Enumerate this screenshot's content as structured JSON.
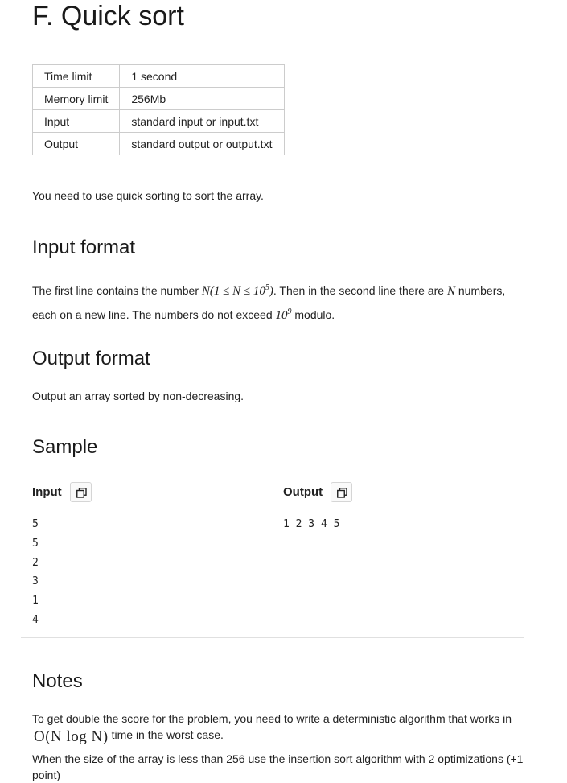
{
  "problem": {
    "title": "F. Quick sort"
  },
  "limits": [
    {
      "key": "Time limit",
      "value": "1 second"
    },
    {
      "key": "Memory limit",
      "value": "256Mb"
    },
    {
      "key": "Input",
      "value": "standard input or input.txt"
    },
    {
      "key": "Output",
      "value": "standard output or output.txt"
    }
  ],
  "legend": "You need to use quick sorting to sort the array.",
  "input_format": {
    "heading": "Input format",
    "text_1": "The first line contains the number ",
    "math_1": "N(1 ≤ N ≤ 10",
    "math_1_sup": "5",
    "math_1_end": ")",
    "text_2": ". Then in the second line there are ",
    "math_2": "N",
    "text_3": " numbers, each on a new line. The numbers do not exceed ",
    "math_3": "10",
    "math_3_sup": "9",
    "text_4": " modulo."
  },
  "output_format": {
    "heading": "Output format",
    "text": "Output an array sorted by non-decreasing."
  },
  "sample": {
    "heading": "Sample",
    "input_label": "Input",
    "output_label": "Output",
    "input": "5\n5\n2\n3\n1\n4",
    "output": "1 2 3 4 5"
  },
  "notes": {
    "heading": "Notes",
    "line_1_a": "To get double the score for the problem, you need to write a deterministic algorithm that works in",
    "bigo": "O(N log N)",
    "line_1_b": "time in the worst case.",
    "line_2": "When the size of the array is less than 256 use the insertion sort algorithm with 2 optimizations (+1 point)"
  },
  "icons": {
    "copy": "copy-icon"
  }
}
